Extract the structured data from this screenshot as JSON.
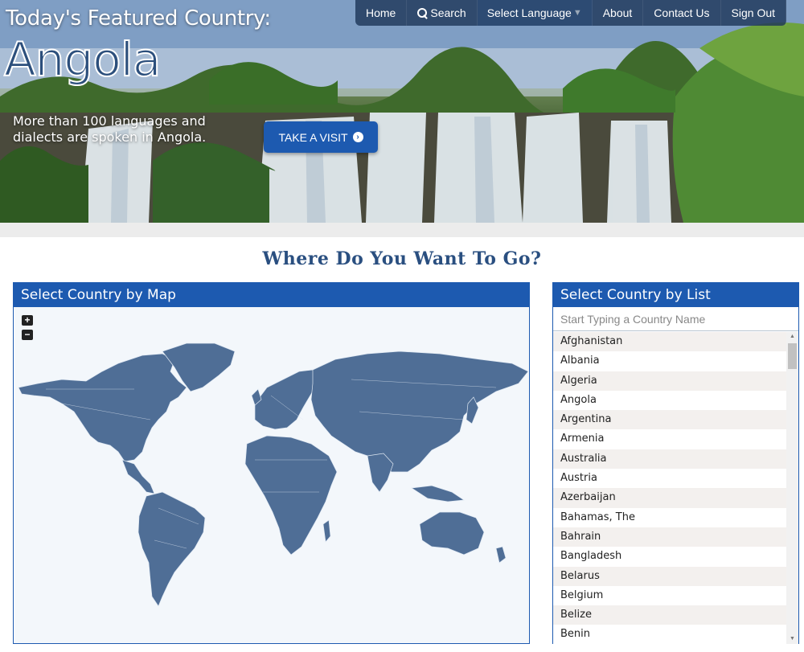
{
  "hero": {
    "kicker": "Today's Featured Country:",
    "country": "Angola",
    "fact": "More than 100 languages and dialects are spoken in Angola.",
    "visit_button": "TAKE A VISIT",
    "visit_icon": "arrow-circle-right-icon"
  },
  "nav": {
    "home": "Home",
    "search": "Search",
    "language": "Select Language",
    "about": "About",
    "contact": "Contact Us",
    "signout": "Sign Out"
  },
  "main": {
    "title": "Where Do You Want To Go?",
    "map_panel": {
      "title": "Select Country by Map",
      "zoom_in": "+",
      "zoom_out": "−"
    },
    "list_panel": {
      "title": "Select Country by List",
      "placeholder": "Start Typing a Country Name",
      "countries": [
        "Afghanistan",
        "Albania",
        "Algeria",
        "Angola",
        "Argentina",
        "Armenia",
        "Australia",
        "Austria",
        "Azerbaijan",
        "Bahamas, The",
        "Bahrain",
        "Bangladesh",
        "Belarus",
        "Belgium",
        "Belize",
        "Benin"
      ]
    }
  },
  "colors": {
    "primary": "#1d5ab0",
    "map_land": "#4f6e96",
    "title": "#2a4f80"
  }
}
